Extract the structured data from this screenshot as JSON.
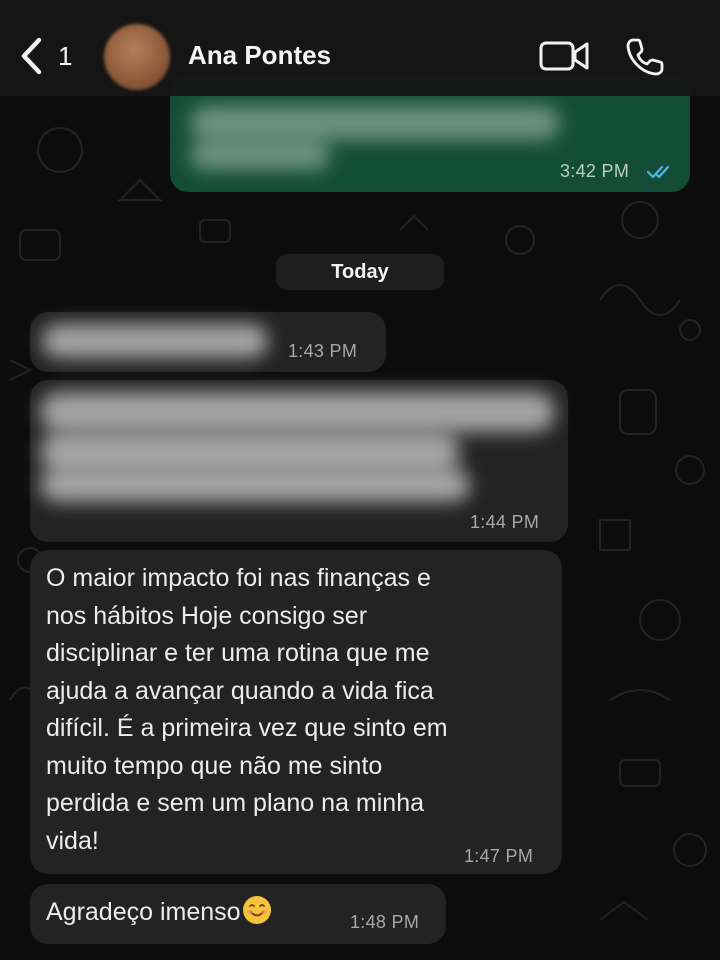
{
  "header": {
    "back_count": "1",
    "contact_name": "Ana Pontes"
  },
  "date_divider": "Today",
  "messages": [
    {
      "direction": "outgoing",
      "text": "",
      "time": "3:42 PM",
      "status": "read",
      "redacted": true
    },
    {
      "direction": "incoming",
      "text": "",
      "time": "1:43 PM",
      "redacted": true
    },
    {
      "direction": "incoming",
      "text": "",
      "time": "1:44 PM",
      "redacted": true
    },
    {
      "direction": "incoming",
      "text": "O maior impacto foi nas finanças e\nnos hábitos Hoje consigo ser\ndisciplinar e ter uma rotina que me\najuda a avançar quando a vida fica\ndifícil. É a primeira vez que sinto em\nmuito tempo que não me sinto\nperdida e sem um plano na minha\nvida!",
      "time": "1:47 PM"
    },
    {
      "direction": "incoming",
      "text": "Agradeço imenso",
      "emoji": "smiling-face-icon",
      "time": "1:48 PM"
    }
  ],
  "colors": {
    "outgoing_bubble": "#144d37",
    "incoming_bubble": "#232323",
    "read_ticks": "#4fb6ec",
    "background": "#0c0c0c"
  },
  "icons": [
    "chevron-left-icon",
    "video-call-icon",
    "phone-call-icon",
    "read-ticks-icon",
    "smiling-face-icon"
  ]
}
